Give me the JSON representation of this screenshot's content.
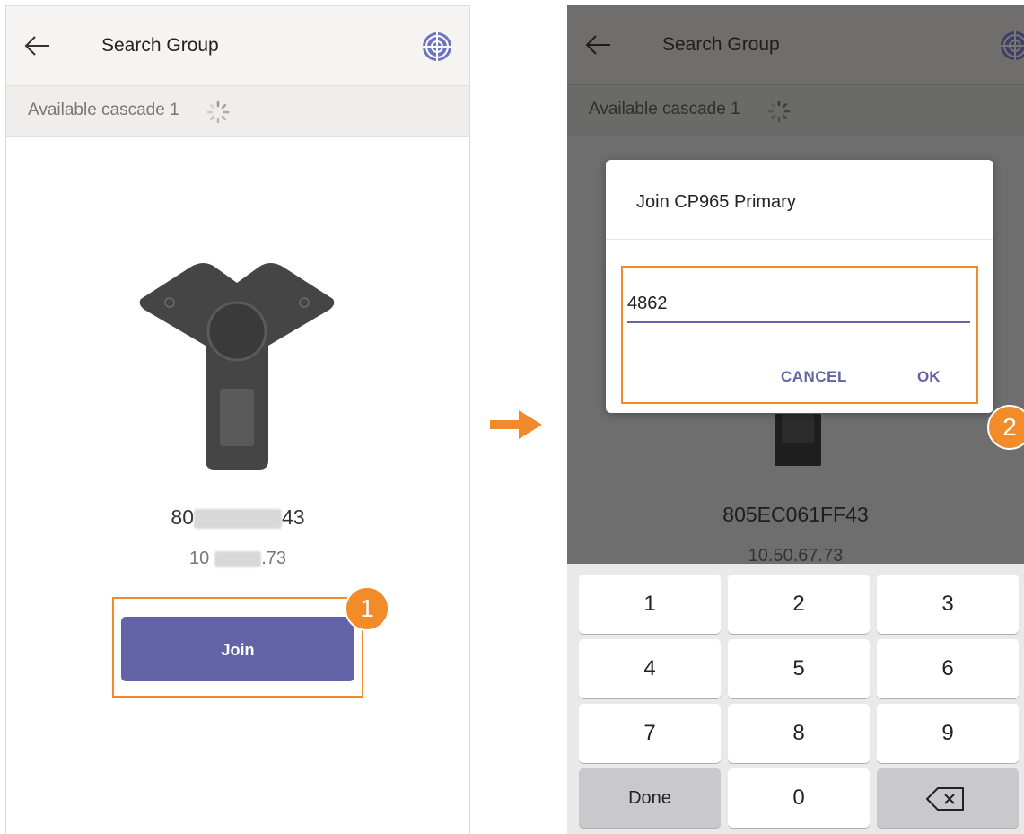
{
  "left_screen": {
    "title": "Search Group",
    "subtitle": "Available cascade 1",
    "device_id_start": "80",
    "device_id_end": "43",
    "ip_start": "10",
    "ip_end": ".73",
    "join_label": "Join",
    "badge": "1"
  },
  "right_screen": {
    "title": "Search Group",
    "subtitle": "Available cascade 1",
    "device_id": "805EC061FF43",
    "ip": "10.50.67.73",
    "dialog": {
      "title": "Join CP965 Primary",
      "input_value": "4862",
      "cancel_label": "CANCEL",
      "ok_label": "OK"
    },
    "badge": "2"
  },
  "keypad": {
    "keys": [
      "1",
      "2",
      "3",
      "4",
      "5",
      "6",
      "7",
      "8",
      "9",
      "Done",
      "0"
    ]
  },
  "colors": {
    "accent": "#6264a7",
    "highlight": "#f08a2c",
    "badge": "#f28c28"
  },
  "icons": [
    "back-arrow-icon",
    "globe-icon",
    "spinner-icon",
    "arrow-right-icon",
    "backspace-icon"
  ]
}
